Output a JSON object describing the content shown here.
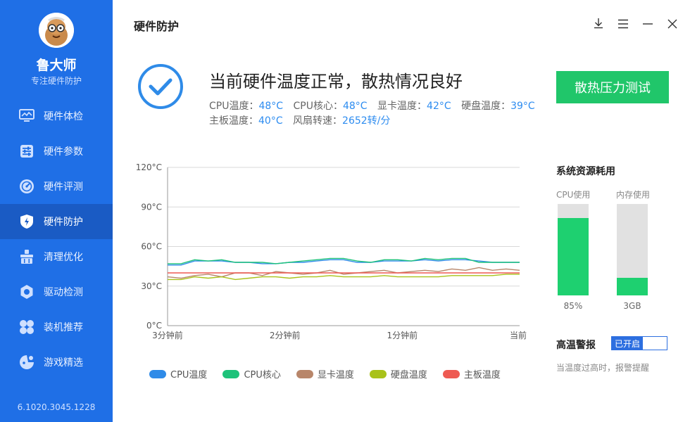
{
  "sidebar": {
    "brand_name": "鲁大师",
    "slogan": "专注硬件防护",
    "version": "6.1020.3045.1228",
    "items": [
      {
        "label": "硬件体检",
        "icon": "monitor-icon",
        "active": false
      },
      {
        "label": "硬件参数",
        "icon": "sliders-icon",
        "active": false
      },
      {
        "label": "硬件评测",
        "icon": "gauge-icon",
        "active": false
      },
      {
        "label": "硬件防护",
        "icon": "shield-bolt-icon",
        "active": true
      },
      {
        "label": "清理优化",
        "icon": "broom-icon",
        "active": false
      },
      {
        "label": "驱动检测",
        "icon": "gear-icon",
        "active": false
      },
      {
        "label": "装机推荐",
        "icon": "grid-icon",
        "active": false
      },
      {
        "label": "游戏精选",
        "icon": "game-icon",
        "active": false
      }
    ]
  },
  "header": {
    "title": "硬件防护",
    "controls": [
      "download-icon",
      "menu-icon",
      "minimize-icon",
      "close-icon"
    ]
  },
  "status": {
    "title": "当前硬件温度正常，散热情况良好",
    "metrics": [
      {
        "label": "CPU温度：",
        "value": "48°C"
      },
      {
        "label": "CPU核心：",
        "value": "48°C"
      },
      {
        "label": "显卡温度：",
        "value": "42°C"
      },
      {
        "label": "硬盘温度：",
        "value": "39°C"
      },
      {
        "label": "主板温度：",
        "value": "40°C"
      },
      {
        "label": "风扇转速：",
        "value": "2652转/分"
      }
    ],
    "test_button": "散热压力测试"
  },
  "chart_data": {
    "type": "line",
    "y_tick_labels": [
      "0°C",
      "30°C",
      "60°C",
      "90°C",
      "120°C"
    ],
    "ylim": [
      0,
      120
    ],
    "x_tick_labels": [
      "3分钟前",
      "2分钟前",
      "1分钟前",
      "当前"
    ],
    "grid": true,
    "legend_position": "bottom",
    "series": [
      {
        "name": "CPU温度",
        "color": "#2f8be8",
        "values": [
          46,
          46,
          49,
          49,
          49,
          48,
          48,
          47,
          47,
          48,
          48,
          49,
          50,
          50,
          48,
          48,
          49,
          49,
          49,
          50,
          49,
          50,
          50,
          49,
          48,
          48,
          48
        ]
      },
      {
        "name": "CPU核心",
        "color": "#1ec27a",
        "values": [
          47,
          47,
          50,
          49,
          50,
          48,
          48,
          48,
          47,
          48,
          49,
          50,
          51,
          51,
          49,
          48,
          50,
          50,
          49,
          51,
          50,
          51,
          51,
          48,
          48,
          48,
          48
        ]
      },
      {
        "name": "显卡温度",
        "color": "#b8866a",
        "values": [
          37,
          36,
          38,
          39,
          37,
          40,
          40,
          38,
          41,
          40,
          39,
          40,
          42,
          39,
          40,
          41,
          42,
          40,
          41,
          42,
          41,
          43,
          42,
          44,
          42,
          43,
          42
        ]
      },
      {
        "name": "硬盘温度",
        "color": "#a9c21a",
        "values": [
          35,
          35,
          37,
          36,
          37,
          35,
          36,
          37,
          37,
          36,
          37,
          37,
          38,
          37,
          37,
          37,
          38,
          37,
          37,
          37,
          37,
          38,
          38,
          38,
          38,
          39,
          39
        ]
      },
      {
        "name": "主板温度",
        "color": "#ee5a52",
        "values": [
          40,
          40,
          40,
          40,
          40,
          40,
          40,
          40,
          40,
          40,
          40,
          40,
          40,
          40,
          40,
          40,
          40,
          40,
          40,
          40,
          40,
          40,
          40,
          40,
          40,
          40,
          40
        ]
      }
    ]
  },
  "resources": {
    "title": "系统资源耗用",
    "cpu": {
      "label": "CPU使用",
      "value": "85%",
      "fraction": 0.85
    },
    "memory": {
      "label": "内存使用",
      "value": "3GB",
      "fraction": 0.19
    }
  },
  "alarm": {
    "label": "高温警报",
    "toggle_label": "已开启",
    "enabled": true,
    "description": "当温度过高时，报警提醒"
  },
  "colors": {
    "sidebar": "#1f6fe6",
    "sidebar_active": "#1a5bc4",
    "accent_green": "#20c66a",
    "value_blue": "#2d8cf0"
  }
}
